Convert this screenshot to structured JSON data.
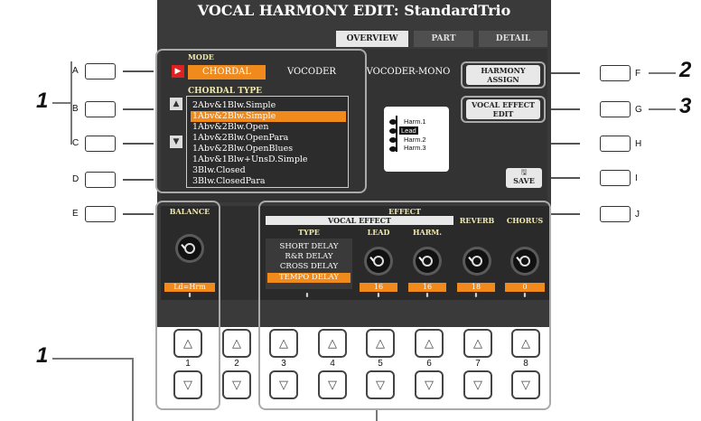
{
  "screen": {
    "title": "VOCAL HARMONY EDIT: StandardTrio",
    "tabs": [
      "OVERVIEW",
      "PART",
      "DETAIL"
    ]
  },
  "mode": {
    "label": "MODE",
    "options": [
      "CHORDAL",
      "VOCODER",
      "VOCODER-MONO"
    ],
    "selected": "CHORDAL"
  },
  "chordal_type": {
    "label": "CHORDAL TYPE",
    "items": [
      "2Abv&1Blw.Simple",
      "1Abv&2Blw.Simple",
      "1Abv&2Blw.Open",
      "1Abv&2Blw.OpenPara",
      "1Abv&2Blw.OpenBlues",
      "1Abv&1Blw+UnsD.Simple",
      "3Blw.Closed",
      "3Blw.ClosedPara"
    ],
    "selected_index": 1
  },
  "harmony_diagram": {
    "labels": [
      "Harm.1",
      "Lead",
      "Harm.2",
      "Harm.3"
    ]
  },
  "right_buttons": {
    "harmony_assign": "HARMONY ASSIGN",
    "vocal_effect_edit": "VOCAL EFFECT EDIT",
    "save": "SAVE"
  },
  "balance": {
    "label": "BALANCE",
    "value": "Ld=Hrm"
  },
  "effect": {
    "label": "EFFECT",
    "vocal_effect_label": "VOCAL EFFECT",
    "type_label": "TYPE",
    "types": [
      "SHORT DELAY",
      "R&R DELAY",
      "CROSS DELAY",
      "TEMPO DELAY"
    ],
    "selected_type": "TEMPO DELAY",
    "lead_label": "LEAD",
    "lead_value": "16",
    "harm_label": "HARM.",
    "harm_value": "16",
    "reverb_label": "REVERB",
    "reverb_value": "18",
    "chorus_label": "CHORUS",
    "chorus_value": "0"
  },
  "side_labels": {
    "left": [
      "A",
      "B",
      "C",
      "D",
      "E"
    ],
    "right": [
      "F",
      "G",
      "H",
      "I",
      "J"
    ]
  },
  "bottom_buttons": [
    "1",
    "2",
    "3",
    "4",
    "5",
    "6",
    "7",
    "8"
  ],
  "callouts": {
    "left_top": "1",
    "left_bottom": "1",
    "right_top": "2",
    "right_mid": "3"
  },
  "colors": {
    "lcd_bg": "#3a3a3a",
    "highlight": "#f08a1c",
    "frame": "#aaaaaa"
  }
}
